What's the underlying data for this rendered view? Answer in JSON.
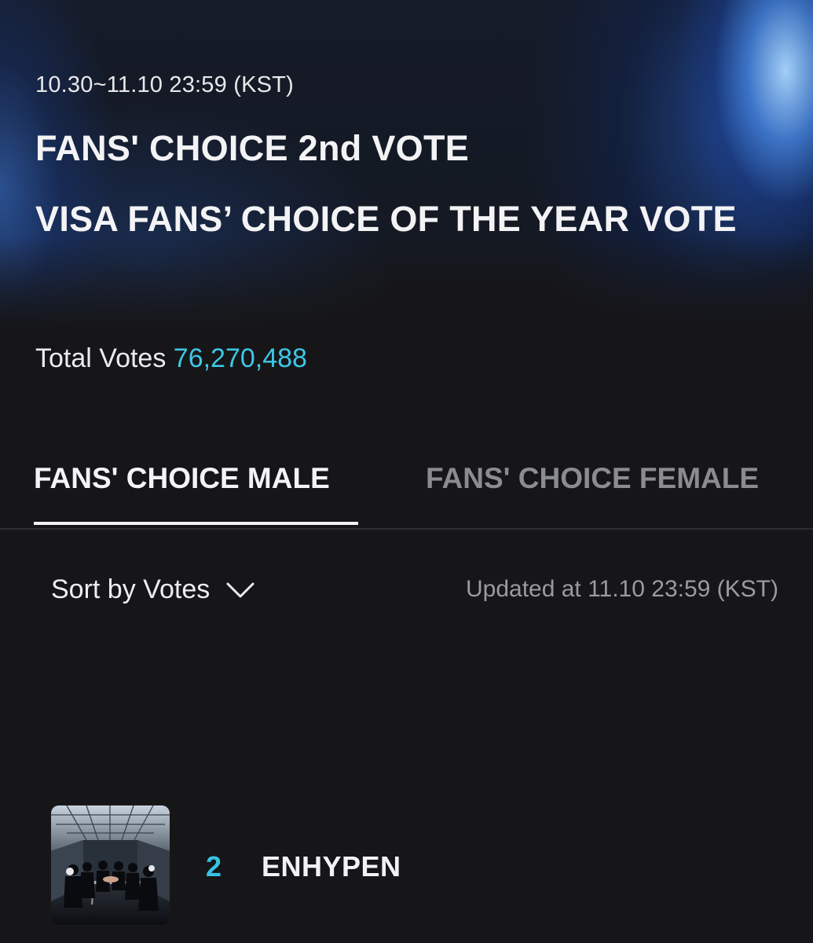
{
  "vote": {
    "period": "10.30~11.10 23:59 (KST)",
    "title_line1": "FANS' CHOICE 2nd VOTE",
    "title_line2": "VISA FANS’ CHOICE OF THE YEAR VOTE",
    "total_label": "Total Votes",
    "total_count": "76,270,488"
  },
  "tabs": [
    {
      "label": "FANS' CHOICE MALE",
      "active": true
    },
    {
      "label": "FANS' CHOICE FEMALE",
      "active": false
    }
  ],
  "controls": {
    "sort_label": "Sort by Votes",
    "sort_icon": "chevron-down-icon",
    "updated_text": "Updated at 11.10 23:59 (KST)"
  },
  "ranking": [
    {
      "rank": "2",
      "artist": "ENHYPEN"
    }
  ],
  "colors": {
    "accent": "#3ec7e6",
    "background": "#161618",
    "inactive_tab": "#8b8c90"
  }
}
